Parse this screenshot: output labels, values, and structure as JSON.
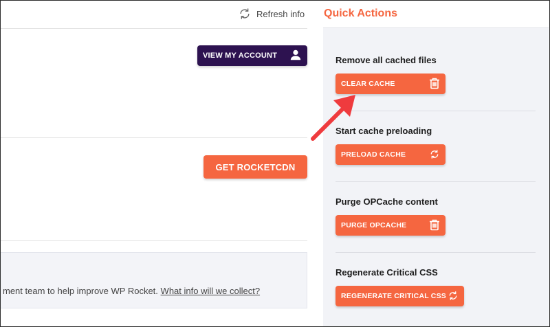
{
  "header": {
    "refresh_label": "Refresh info"
  },
  "account": {
    "view_account_label": "VIEW MY ACCOUNT"
  },
  "cdn": {
    "get_rocketcdn_label": "GET ROCKETCDN"
  },
  "notice": {
    "text": "ment team to help improve WP Rocket.",
    "link": "What info will we collect?"
  },
  "quick_actions": {
    "title": "Quick Actions",
    "items": [
      {
        "label": "Remove all cached files",
        "button": "CLEAR CACHE",
        "icon": "trash-icon"
      },
      {
        "label": "Start cache preloading",
        "button": "PRELOAD CACHE",
        "icon": "refresh-icon"
      },
      {
        "label": "Purge OPCache content",
        "button": "PURGE OPCACHE",
        "icon": "trash-icon"
      },
      {
        "label": "Regenerate Critical CSS",
        "button": "REGENERATE CRITICAL CSS",
        "icon": "refresh-icon"
      }
    ]
  },
  "colors": {
    "accent": "#f56640",
    "dark": "#2d1250",
    "annotation_arrow": "#ef3b3e"
  }
}
